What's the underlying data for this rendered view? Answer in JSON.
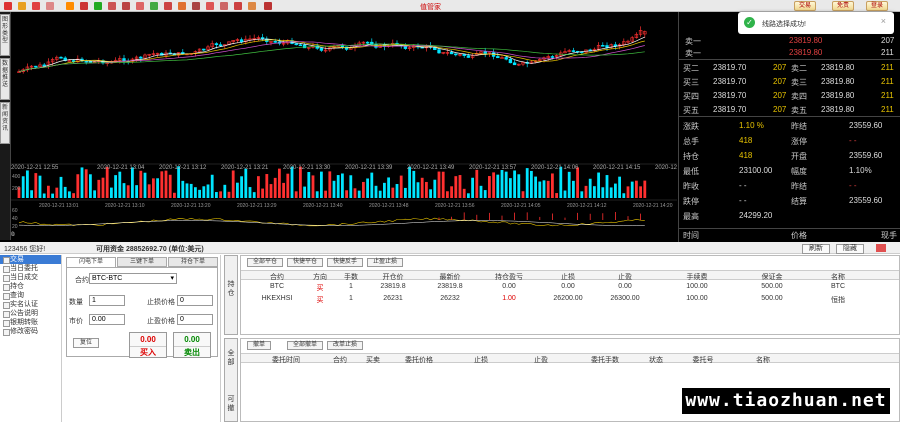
{
  "toolbar": {
    "title": "值管家",
    "btn_trade": "交易",
    "btn_disclaimer": "免责",
    "btn_login": "登录"
  },
  "left_tabs": [
    "图形类型",
    "数据推送",
    "新闻资讯"
  ],
  "toast": {
    "message": "线路选择成功!"
  },
  "chart": {
    "main_times": [
      "2020-12-21 12:55",
      "2020-12-21 13:04",
      "2020-12-21 13:12",
      "2020-12-21 13:21",
      "2020-12-21 13:30",
      "2020-12-21 13:39",
      "2020-12-21 13:49",
      "2020-12-21 13:57",
      "2020-12-21 14:06",
      "2020-12-21 14:15",
      "2020-12-21 14:24"
    ],
    "vol_times": [
      "2020-12-21 13:01",
      "2020-12-21 13:10",
      "2020-12-21 13:20",
      "2020-12-21 13:29",
      "2020-12-21 13:40",
      "2020-12-21 13:48",
      "2020-12-21 13:56",
      "2020-12-21 14:05",
      "2020-12-21 14:12",
      "2020-12-21 14:20"
    ],
    "vol_axis": [
      "400",
      "200"
    ],
    "osc_axis": [
      "60",
      "40",
      "20",
      "0"
    ],
    "price_axis": [
      "0",
      "1"
    ]
  },
  "quote": {
    "ask1": {
      "label": "卖一",
      "price": "23819.80",
      "vol": "207"
    },
    "bid1": {
      "label": "卖一",
      "price": "23819.80",
      "vol": "211"
    },
    "levels": [
      {
        "b": "买二",
        "bp": "23819.70",
        "bv": "207",
        "s": "卖二",
        "sp": "23819.80",
        "sv": "211"
      },
      {
        "b": "买三",
        "bp": "23819.70",
        "bv": "207",
        "s": "卖三",
        "sp": "23819.80",
        "sv": "211"
      },
      {
        "b": "买四",
        "bp": "23819.70",
        "bv": "207",
        "s": "卖四",
        "sp": "23819.80",
        "sv": "211"
      },
      {
        "b": "买五",
        "bp": "23819.70",
        "bv": "207",
        "s": "卖五",
        "sp": "23819.80",
        "sv": "211"
      }
    ],
    "stats": [
      {
        "l1": "涨跌",
        "v1": "1.10 %",
        "l2": "昨结",
        "v2": "23559.60"
      },
      {
        "l1": "总手",
        "v1": "418",
        "l2": "涨停",
        "v2": "- -"
      },
      {
        "l1": "持仓",
        "v1": "418",
        "l2": "开盘",
        "v2": "23559.60"
      },
      {
        "l1": "最低",
        "v1": "23100.00",
        "l2": "幅度",
        "v2": "1.10%"
      },
      {
        "l1": "昨收",
        "v1": "- -",
        "l2": "昨结",
        "v2": "- -"
      },
      {
        "l1": "跌停",
        "v1": "- -",
        "l2": "结算",
        "v2": "23559.60"
      },
      {
        "l1": "最高",
        "v1": "24299.20",
        "l2": "",
        "v2": ""
      }
    ],
    "footer": {
      "time": "时间",
      "price": "价格",
      "vol": "现手"
    }
  },
  "account": {
    "user": "123456 您好!",
    "funds": "可用资金 28852692.70 (单位:美元)",
    "refresh": "刷新",
    "hide": "隐藏"
  },
  "tree": [
    "交易",
    "当日委托",
    "当日成交",
    "持仓",
    "查询",
    "实名认证",
    "公告说明",
    "银期转账",
    "修改密码"
  ],
  "order": {
    "tabs": [
      "闪电下单",
      "三键下单",
      "持仓下单"
    ],
    "contract_label": "合约",
    "contract_value": "BTC-BTC",
    "qty_label": "数量",
    "qty_value": "1",
    "price_label": "市价",
    "price_value": "0.00",
    "stop_loss_label": "止损价格",
    "stop_loss_value": "0",
    "take_profit_label": "止盈价格",
    "take_profit_value": "0",
    "reset": "复位",
    "buy_value": "0.00",
    "buy_label": "买入",
    "sell_value": "0.00",
    "sell_label": "卖出"
  },
  "positions": {
    "side_label": "持仓",
    "buttons": [
      "全部平仓",
      "快捷平仓",
      "快捷反手",
      "止盈止损"
    ],
    "headers": [
      "合约",
      "方向",
      "手数",
      "开仓价",
      "最新价",
      "持仓盈亏",
      "止损",
      "止盈",
      "手续费",
      "保证金",
      "名称"
    ],
    "rows": [
      [
        "BTC",
        "买",
        "1",
        "23819.8",
        "23819.8",
        "0.00",
        "0.00",
        "0.00",
        "100.00",
        "500.00",
        "BTC"
      ],
      [
        "HKEXHSI",
        "买",
        "1",
        "26231",
        "26232",
        "1.00",
        "26200.00",
        "26300.00",
        "100.00",
        "500.00",
        "恒指"
      ]
    ]
  },
  "orders": {
    "side_label": "全部",
    "side_label2": "可撤",
    "buttons": [
      "撤单",
      "全部撤单",
      "改单止损"
    ],
    "headers": [
      "委托时间",
      "合约",
      "买卖",
      "委托价格",
      "止损",
      "止盈",
      "委托手数",
      "状态",
      "委托号",
      "名称"
    ]
  },
  "watermark": "www.tiaozhuan.net"
}
